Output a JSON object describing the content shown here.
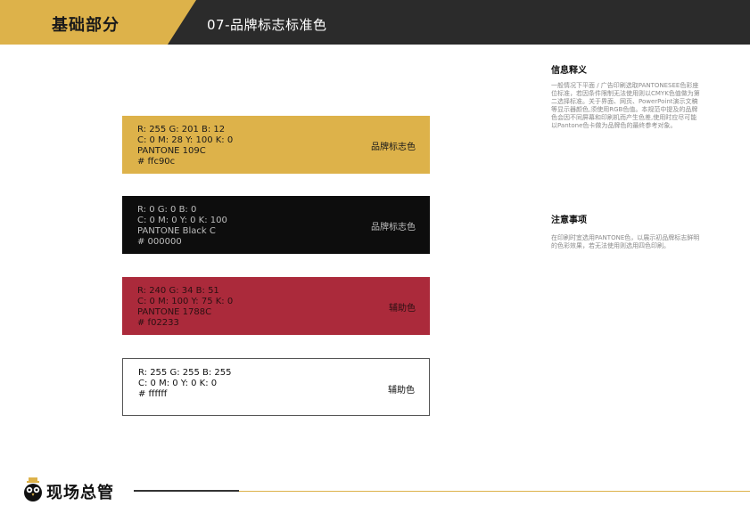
{
  "header": {
    "section_title": "基础部分",
    "page_title": "07-品牌标志标准色"
  },
  "swatches": [
    {
      "rgb": "R: 255  G: 201  B: 12",
      "cmyk": "C: 0  M: 28  Y: 100  K: 0",
      "pantone": "PANTONE 109C",
      "hex": "# ffc90c",
      "role": "品牌标志色",
      "color": "#ddb24a"
    },
    {
      "rgb": "R: 0  G: 0  B: 0",
      "cmyk": "C: 0  M: 0  Y: 0  K: 100",
      "pantone": "PANTONE Black C",
      "hex": "# 000000",
      "role": "品牌标志色",
      "color": "#0d0d0d"
    },
    {
      "rgb": "R: 240  G: 34  B: 51",
      "cmyk": "C: 0  M: 100  Y: 75  K: 0",
      "pantone": "PANTONE 1788C",
      "hex": "# f02233",
      "role": "辅助色",
      "color": "#ab2a3b"
    },
    {
      "rgb": "R: 255  G: 255  B: 255",
      "cmyk": "C: 0  M: 0  Y: 0  K: 0",
      "hex": "# ffffff",
      "role": "辅助色",
      "color": "#ffffff"
    }
  ],
  "notes": {
    "info_title": "信息释义",
    "info_body": "一般情况下平面 / 广告印刷选取PANTONESEE色彩座位标准，若因条件限制无法使用则以CMYK色值做为第二选择标准。关于界面、网页、PowerPoint演示文稿等显示器颜色,须使用RGB色值。本规范中提及的品牌色会因不同屏幕和印刷机而产生色差,使用时应尽可能以Pantone色卡做为品牌色的最终参考对象。",
    "caution_title": "注意事项",
    "caution_body": "在印刷时宜选用PANTONE色，以展示初品牌标志鲜明的色彩效果，若无法使用则选用四色印刷。"
  },
  "footer": {
    "logo_text": "现场总管"
  },
  "colors": {
    "gold": "#ddb24a",
    "dark": "#2b2b2b"
  }
}
